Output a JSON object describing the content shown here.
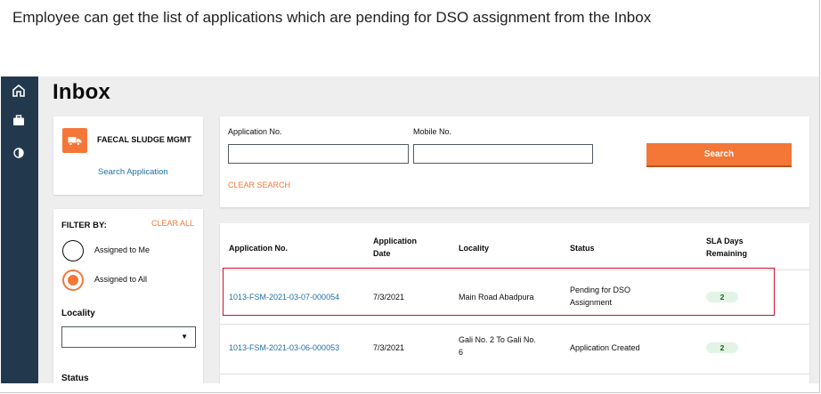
{
  "caption": "Employee can get the list of applications which are pending for DSO assignment from the Inbox",
  "sidebar": {
    "icons": [
      "home-icon",
      "briefcase-icon",
      "contrast-icon"
    ]
  },
  "page": {
    "title": "Inbox"
  },
  "module_card": {
    "title": "FAECAL SLUDGE MGMT",
    "link": "Search Application",
    "icon": "truck-icon"
  },
  "search": {
    "application_no_label": "Application No.",
    "mobile_no_label": "Mobile No.",
    "application_no_value": "",
    "mobile_no_value": "",
    "search_button": "Search",
    "clear_search": "CLEAR SEARCH"
  },
  "filter": {
    "heading": "FILTER BY:",
    "clear_all": "CLEAR ALL",
    "options": [
      {
        "label": "Assigned to Me",
        "selected": false
      },
      {
        "label": "Assigned to All",
        "selected": true
      }
    ],
    "locality_label": "Locality",
    "locality_value": "",
    "status_label": "Status"
  },
  "table": {
    "headers": {
      "application_no": "Application No.",
      "application_date_line1": "Application",
      "application_date_line2": "Date",
      "locality": "Locality",
      "status": "Status",
      "sla_line1": "SLA Days",
      "sla_line2": "Remaining"
    },
    "rows": [
      {
        "application_no": "1013-FSM-2021-03-07-000054",
        "date": "7/3/2021",
        "locality": "Main Road Abadpura",
        "locality_line2": "",
        "status_line1": "Pending for DSO",
        "status_line2": "Assignment",
        "sla": "2"
      },
      {
        "application_no": "1013-FSM-2021-03-06-000053",
        "date": "7/3/2021",
        "locality": "Gali No. 2 To Gali No.",
        "locality_line2": "6",
        "status_line1": "Application Created",
        "status_line2": "",
        "sla": "2"
      }
    ]
  },
  "colors": {
    "accent": "#f47738",
    "sidebar": "#22394d",
    "link": "#1f6fa8",
    "highlight": "#c8102e",
    "sla_pill_bg": "#e2f4e6"
  }
}
